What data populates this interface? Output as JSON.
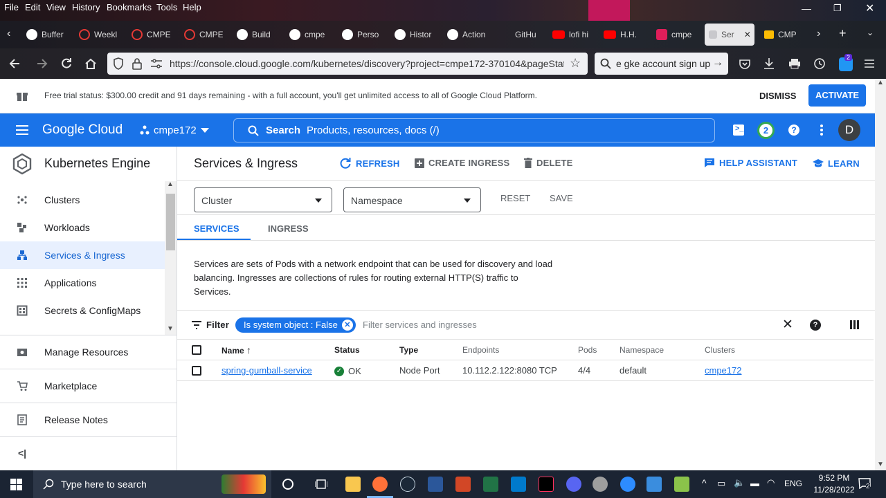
{
  "browser": {
    "menu": [
      "File",
      "Edit",
      "View",
      "History",
      "Bookmarks",
      "Tools",
      "Help"
    ],
    "tabs": [
      {
        "label": "Buffer",
        "color": "#ffffff"
      },
      {
        "label": "Weekl",
        "color": "#e53935"
      },
      {
        "label": "CMPE",
        "color": "#e53935"
      },
      {
        "label": "CMPE",
        "color": "#e53935"
      },
      {
        "label": "Build",
        "color": "#ffffff"
      },
      {
        "label": "cmpe",
        "color": "#ffffff"
      },
      {
        "label": "Perso",
        "color": "#ffffff"
      },
      {
        "label": "Histor",
        "color": "#ffffff"
      },
      {
        "label": "Action",
        "color": "#ffffff"
      },
      {
        "label": "GitHu",
        "color": "#ffffff"
      },
      {
        "label": "lofi hi",
        "color": "#ff0000"
      },
      {
        "label": "H.H.",
        "color": "#ff0000"
      },
      {
        "label": "cmpe",
        "color": "#e01e5a"
      },
      {
        "label": "Ser",
        "color": "#ffffff",
        "active": true
      },
      {
        "label": "CMP",
        "color": "#fbbc04"
      }
    ],
    "url": "https://console.cloud.google.com/kubernetes/discovery?project=cmpe172-370104&pageStat",
    "search_text": "e gke account sign up",
    "badge_count": "2"
  },
  "trial": {
    "text": "Free trial status: $300.00 credit and 91 days remaining - with a full account, you'll get unlimited access to all of Google Cloud Platform.",
    "dismiss": "DISMISS",
    "activate": "ACTIVATE"
  },
  "header": {
    "logo": "Google Cloud",
    "project": "cmpe172",
    "search_label": "Search",
    "search_placeholder": "Products, resources, docs (/)",
    "notif_count": "2",
    "avatar": "D"
  },
  "sidebar": {
    "title": "Kubernetes Engine",
    "items": [
      {
        "label": "Clusters",
        "icon": "clusters-icon"
      },
      {
        "label": "Workloads",
        "icon": "workloads-icon"
      },
      {
        "label": "Services & Ingress",
        "icon": "services-icon",
        "selected": true
      },
      {
        "label": "Applications",
        "icon": "applications-icon"
      },
      {
        "label": "Secrets & ConfigMaps",
        "icon": "secrets-icon"
      }
    ],
    "bottom": [
      {
        "label": "Manage Resources",
        "icon": "manage-resources-icon"
      },
      {
        "label": "Marketplace",
        "icon": "marketplace-icon"
      },
      {
        "label": "Release Notes",
        "icon": "release-notes-icon"
      }
    ]
  },
  "main": {
    "title": "Services & Ingress",
    "refresh": "REFRESH",
    "create_ingress": "CREATE INGRESS",
    "delete": "DELETE",
    "help_assistant": "HELP ASSISTANT",
    "learn": "LEARN",
    "cluster_select": "Cluster",
    "namespace_select": "Namespace",
    "reset": "RESET",
    "save": "SAVE",
    "tabs": [
      "SERVICES",
      "INGRESS"
    ],
    "description": "Services are sets of Pods with a network endpoint that can be used for discovery and load balancing. Ingresses are collections of rules for routing external HTTP(S) traffic to Services.",
    "filter_label": "Filter",
    "filter_chip": "Is system object : False",
    "filter_placeholder": "Filter services and ingresses",
    "columns": [
      "Name",
      "Status",
      "Type",
      "Endpoints",
      "Pods",
      "Namespace",
      "Clusters"
    ],
    "rows": [
      {
        "name": "spring-gumball-service",
        "status": "OK",
        "type": "Node Port",
        "endpoints": "10.112.2.122:8080 TCP",
        "pods": "4/4",
        "namespace": "default",
        "cluster": "cmpe172"
      }
    ]
  },
  "taskbar": {
    "search_placeholder": "Type here to search",
    "lang": "ENG",
    "time": "9:52 PM",
    "date": "11/28/2022",
    "notif": "2"
  }
}
